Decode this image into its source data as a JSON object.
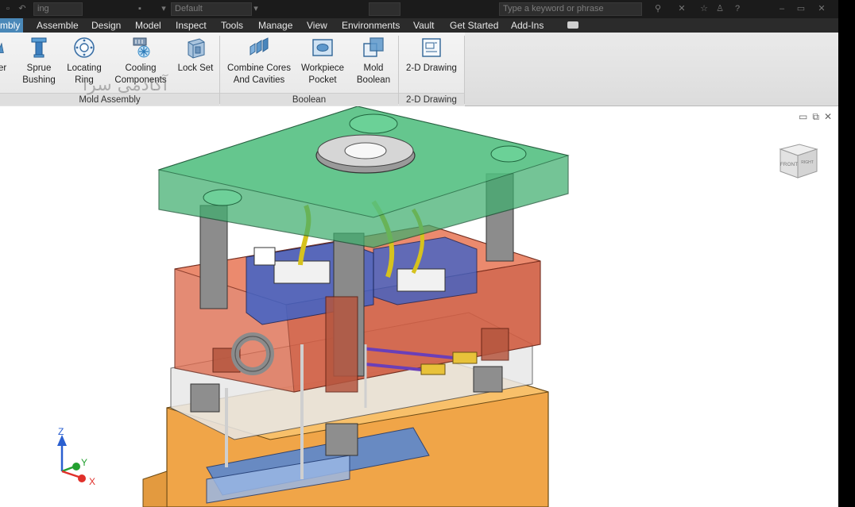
{
  "titlebar": {
    "field_1": "ing",
    "field_2": "Default",
    "search_placeholder": "Type a keyword or phrase"
  },
  "menu": {
    "tabs": [
      "mbly",
      "Assemble",
      "Design",
      "Model",
      "Inspect",
      "Tools",
      "Manage",
      "View",
      "Environments",
      "Vault",
      "Get Started",
      "Add-Ins"
    ],
    "active_index": 0
  },
  "ribbon": {
    "mold_assembly": {
      "buttons": [
        {
          "line1": "er",
          "line2": ""
        },
        {
          "line1": "Sprue",
          "line2": "Bushing"
        },
        {
          "line1": "Locating",
          "line2": "Ring"
        },
        {
          "line1": "Cooling",
          "line2": "Components"
        },
        {
          "line1": "Lock Set",
          "line2": ""
        }
      ],
      "footer": "Mold Assembly"
    },
    "boolean": {
      "buttons": [
        {
          "line1": "Combine Cores",
          "line2": "And Cavities"
        },
        {
          "line1": "Workpiece",
          "line2": "Pocket"
        },
        {
          "line1": "Mold",
          "line2": "Boolean"
        }
      ],
      "footer": "Boolean"
    },
    "drawing": {
      "buttons": [
        {
          "line1": "2-D Drawing",
          "line2": ""
        }
      ],
      "footer": "2-D Drawing"
    },
    "watermark": "آکادمی سرا"
  },
  "viewcube": {
    "front": "FRONT",
    "right": "RIGHT"
  },
  "triad": {
    "x": "X",
    "y": "Y",
    "z": "Z"
  },
  "colors": {
    "active_tab": "#4a88b8",
    "clamp_plate": "#3fae6e",
    "cavity_plate": "#d9654a",
    "base_plate": "#eda64c",
    "axis_x": "#e0302a",
    "axis_y": "#23a030",
    "axis_z": "#2a5fd0"
  }
}
